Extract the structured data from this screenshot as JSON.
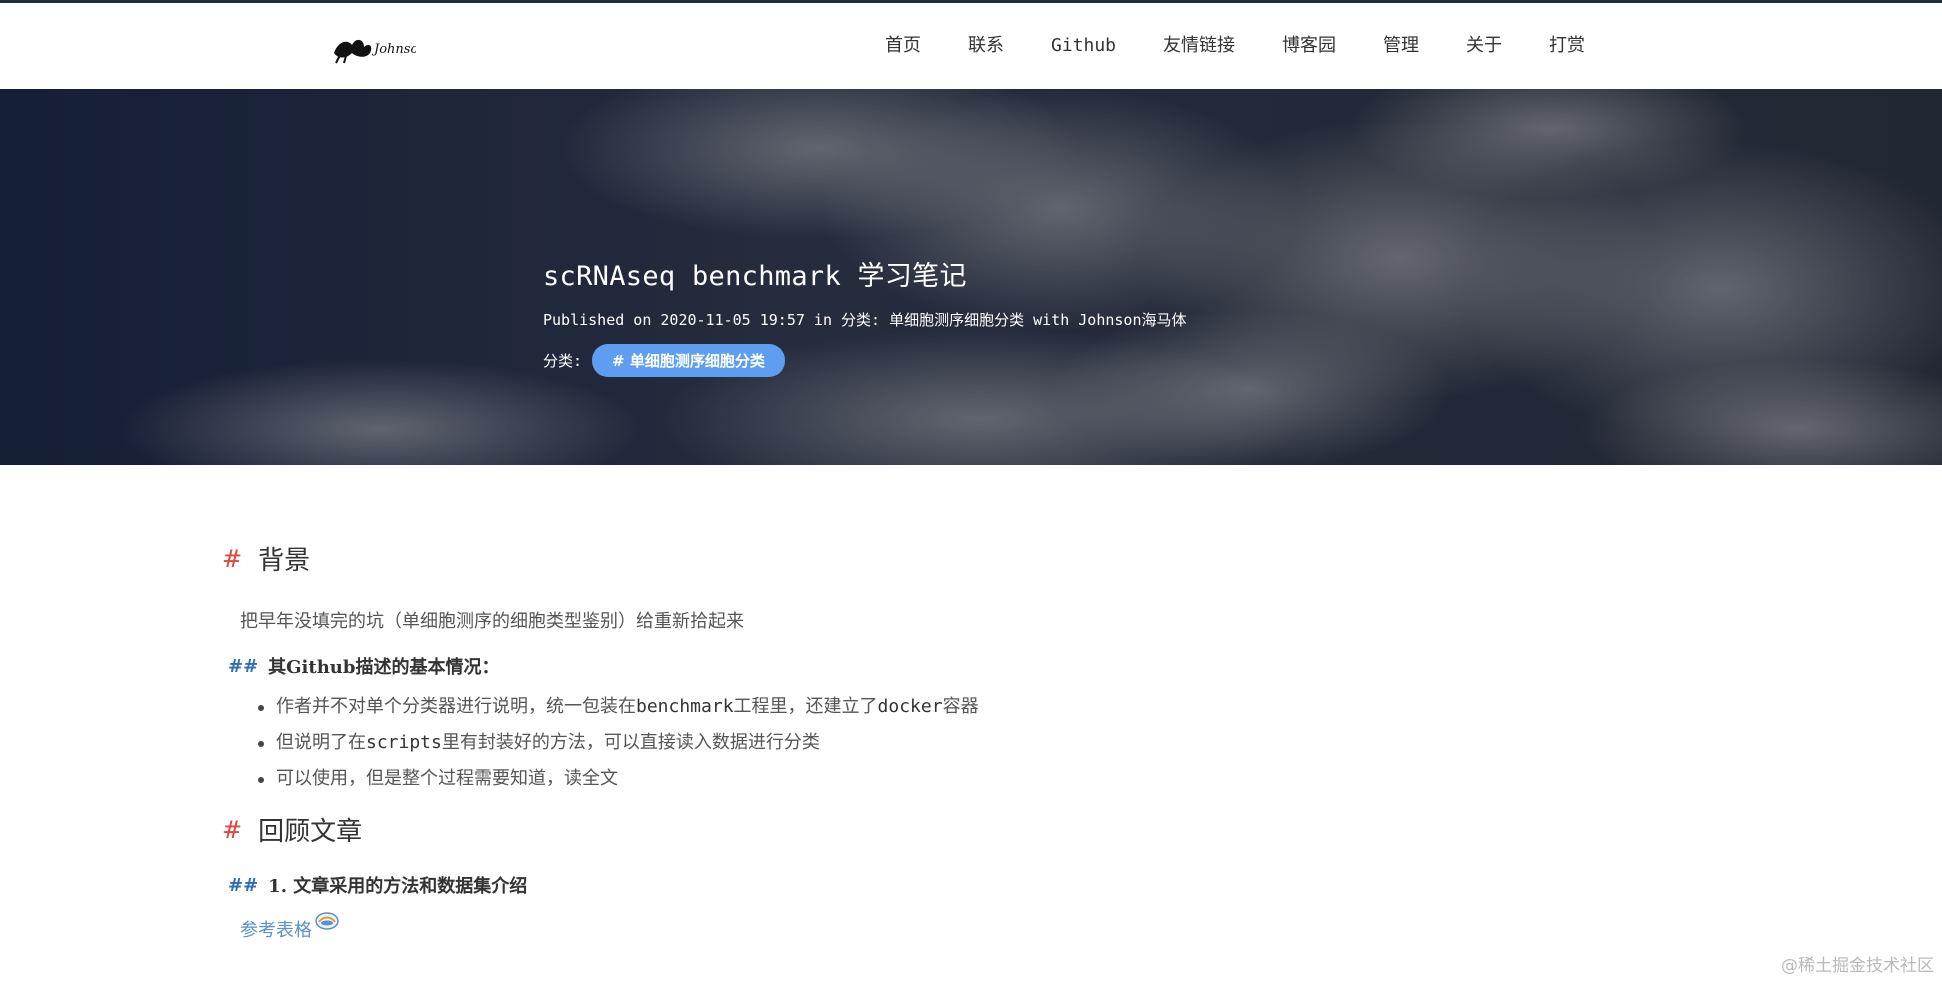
{
  "nav": {
    "logo_alt": "Johnson",
    "items": [
      "首页",
      "联系",
      "Github",
      "友情链接",
      "博客园",
      "管理",
      "关于",
      "打赏"
    ]
  },
  "hero": {
    "title": "scRNAseq benchmark 学习笔记",
    "meta": "Published on 2020-11-05 19:57 in 分类: 单细胞测序细胞分类 with Johnson海马体",
    "category_label": "分类:",
    "category_tag": "# 单细胞测序细胞分类"
  },
  "content": {
    "sec1": {
      "hash": "#",
      "title": "背景"
    },
    "intro": "把早年没填完的坑（单细胞测序的细胞类型鉴别）给重新拾起来",
    "sub1": {
      "hash": "##",
      "title": "其Github描述的基本情况："
    },
    "bullets": [
      {
        "a": "作者并不对单个分类器进行说明，统一包装在",
        "b": "benchmark",
        "c": "工程里，还建立了",
        "d": "docker",
        "e": "容器"
      },
      {
        "a": "但说明了在",
        "b": "scripts",
        "c": "里有封装好的方法，可以直接读入数据进行分类"
      },
      {
        "a": "可以使用，但是整个过程需要知道，读全文"
      }
    ],
    "sec2": {
      "hash": "#",
      "title": "回顾文章"
    },
    "sub2": {
      "hash": "##",
      "title": "1. 文章采用的方法和数据集介绍"
    },
    "ref_link": "参考表格"
  },
  "watermark": "@稀土掘金技术社区",
  "colors": {
    "hero_bg": "#1d2637",
    "tag_bg": "#5f9df0",
    "h1_hash": "#e0473e",
    "h2_hash": "#2f6db3",
    "link": "#5a8fd0"
  }
}
